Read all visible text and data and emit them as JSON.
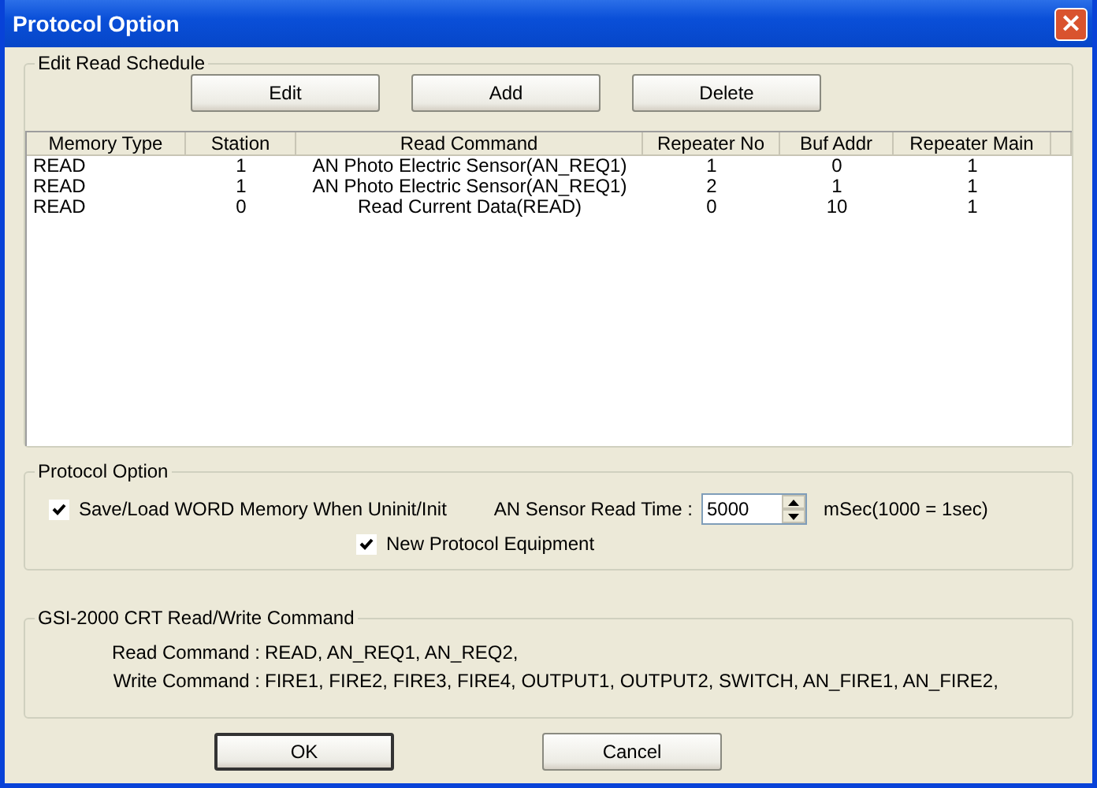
{
  "window": {
    "title": "Protocol Option",
    "close": "×"
  },
  "schedule": {
    "title": "Edit Read Schedule",
    "buttons": [
      "Edit",
      "Add",
      "Delete"
    ],
    "columns": [
      "Memory Type",
      "Station",
      "Read Command",
      "Repeater No",
      "Buf Addr",
      "Repeater Main"
    ],
    "rows": [
      [
        "READ",
        "1",
        "AN Photo Electric Sensor(AN_REQ1)",
        "1",
        "0",
        "1"
      ],
      [
        "READ",
        "1",
        "AN Photo Electric Sensor(AN_REQ1)",
        "2",
        "1",
        "1"
      ],
      [
        "READ",
        "0",
        "Read Current Data(READ)",
        "0",
        "10",
        "1"
      ]
    ]
  },
  "protocol_option": {
    "title": "Protocol Option",
    "save_load": {
      "label": "Save/Load WORD Memory When Uninit/Init",
      "checked": true
    },
    "read_time": {
      "label": "AN Sensor Read Time :",
      "value": "5000",
      "unit": "mSec(1000 = 1sec)"
    },
    "new_protocol": {
      "label": "New Protocol Equipment",
      "checked": true
    }
  },
  "commands": {
    "title": "GSI-2000 CRT Read/Write Command",
    "lines": [
      {
        "label": "Read Command :",
        "value": "READ, AN_REQ1, AN_REQ2,"
      },
      {
        "label": "Write Command :",
        "value": "FIRE1, FIRE2, FIRE3, FIRE4, OUTPUT1, OUTPUT2, SWITCH, AN_FIRE1, AN_FIRE2,"
      }
    ]
  },
  "buttons": [
    {
      "label": "OK",
      "default": true
    },
    {
      "label": "Cancel",
      "default": false
    }
  ]
}
